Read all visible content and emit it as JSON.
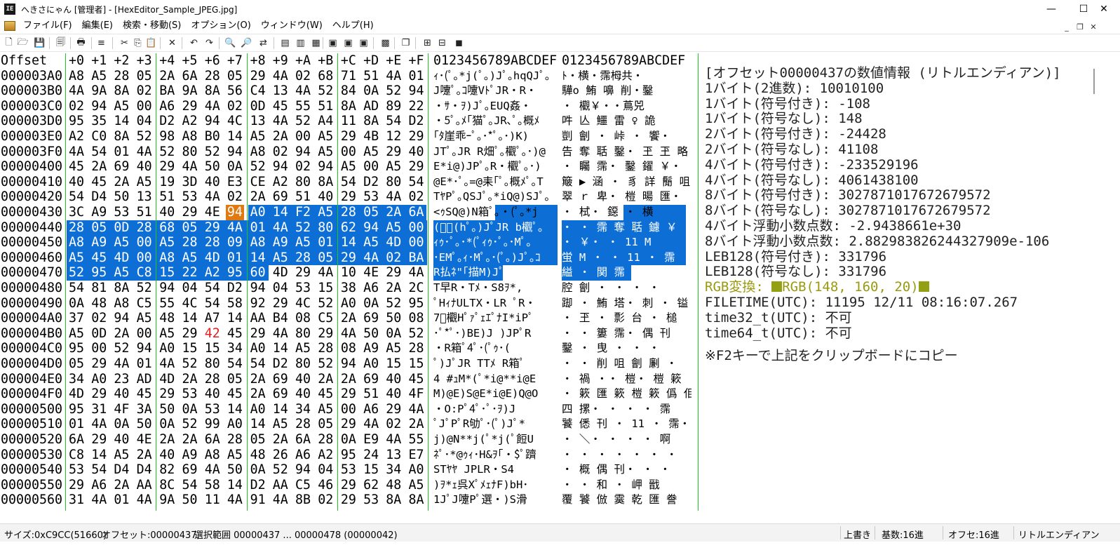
{
  "window": {
    "app_icon_text": "IE",
    "title": "へきさにゃん [管理者] - [HexEditor_Sample_JPEG.jpg]",
    "min_glyph": "—",
    "max_glyph": "☐",
    "close_glyph": "✕"
  },
  "menu": {
    "items": [
      "ファイル(F)",
      "編集(E)",
      "検索・移動(S)",
      "オプション(O)",
      "ウィンドウ(W)",
      "ヘルプ(H)"
    ],
    "mdi_min": "_",
    "mdi_restore": "❐",
    "mdi_close": "✕"
  },
  "toolbar": {
    "icons": [
      "new-file",
      "open-folder",
      "save",
      "properties",
      "print",
      "list",
      "cut",
      "copy",
      "paste",
      "delete",
      "undo",
      "redo",
      "search",
      "search-next",
      "replace",
      "insert-before",
      "insert-after",
      "insert-end",
      "mark-a",
      "mark-b",
      "mark-c",
      "struct",
      "window-list",
      "grid-1",
      "grid-2",
      "grid-3"
    ],
    "glyphs": [
      "🗋",
      "🗁",
      "💾",
      "🗐",
      "🖶",
      "≡",
      "✂",
      "⎘",
      "📋",
      "✕",
      "↶",
      "↷",
      "🔍",
      "🔎",
      "⇄",
      "▤",
      "▥",
      "▦",
      "▣",
      "▣",
      "▣",
      "▩",
      "❐",
      "⊞",
      "⊟",
      "◼"
    ]
  },
  "editor": {
    "offset_header": "Offset",
    "hex_headers": [
      "+0",
      "+1",
      "+2",
      "+3",
      "+4",
      "+5",
      "+6",
      "+7",
      "+8",
      "+9",
      "+A",
      "+B",
      "+C",
      "+D",
      "+E",
      "+F"
    ],
    "text_header_1": "0123456789ABCDEF",
    "text_header_2": "0123456789ABCDEF",
    "rows": [
      {
        "offset": "000003A0",
        "hex": [
          "A8",
          "A5",
          "28",
          "05",
          "2A",
          "6A",
          "28",
          "05",
          "29",
          "4A",
          "02",
          "68",
          "71",
          "51",
          "4A",
          "01"
        ],
        "text1": "ｨ･(ﾟ｡*j(ﾟ｡)Jﾟ｡hqQJﾟ｡",
        "text2": "ﾄ・横・霈栂共・"
      },
      {
        "offset": "000003B0",
        "hex": [
          "4A",
          "9A",
          "8A",
          "02",
          "BA",
          "9A",
          "8A",
          "56",
          "C4",
          "13",
          "4A",
          "52",
          "84",
          "0A",
          "52",
          "94"
        ],
        "text1": "J嚔ﾟ｡ｺ嚔VﾄﾟJR・R・",
        "text2": "驊o 鮪 嚊 削・鑿"
      },
      {
        "offset": "000003C0",
        "hex": [
          "02",
          "94",
          "A5",
          "00",
          "A6",
          "29",
          "4A",
          "02",
          "0D",
          "45",
          "55",
          "51",
          "8A",
          "AD",
          "89",
          "22"
        ],
        "text1": "・ｻ・ｦ)Jﾟ｡EUQ姦・",
        "text2": "・ 欟￥・・蔦兕"
      },
      {
        "offset": "000003D0",
        "hex": [
          "95",
          "35",
          "14",
          "04",
          "D2",
          "A2",
          "94",
          "4C",
          "13",
          "4A",
          "52",
          "A4",
          "11",
          "8A",
          "54",
          "D2"
        ],
        "text1": "・5ﾟ｡ﾒ｢猫ﾟ｡JR､ﾟ｡概ﾒ",
        "text2": "吽 亾 鱷 雷 ♀ 詭"
      },
      {
        "offset": "000003E0",
        "hex": [
          "A2",
          "C0",
          "8A",
          "52",
          "98",
          "A8",
          "B0",
          "14",
          "A5",
          "2A",
          "00",
          "A5",
          "29",
          "4B",
          "12",
          "29"
        ],
        "text1": "｢ﾀ崖乖ｰﾟ｡･*ﾟ｡･)K)",
        "text2": "剴 劊 ・ 峠 ・ 饗・"
      },
      {
        "offset": "000003F0",
        "hex": [
          "4A",
          "54",
          "01",
          "4A",
          "52",
          "80",
          "52",
          "94",
          "A8",
          "02",
          "94",
          "A5",
          "00",
          "A5",
          "29",
          "40"
        ],
        "text1": "JTﾟ｡JR R畑ﾟ｡欟ﾟ｡･)@",
        "text2": "告 奪 聒 鑿・ 玊 玊 略"
      },
      {
        "offset": "00000400",
        "hex": [
          "45",
          "2A",
          "69",
          "40",
          "29",
          "4A",
          "50",
          "0A",
          "52",
          "94",
          "02",
          "94",
          "A5",
          "00",
          "A5",
          "29"
        ],
        "text1": "E*i@)JPﾟ｡R・欟ﾟ｡･)",
        "text2": "・ 矚 霈・ 鑿 鑃 ￥・"
      },
      {
        "offset": "00000410",
        "hex": [
          "40",
          "45",
          "2A",
          "A5",
          "19",
          "3D",
          "40",
          "E3",
          "CE",
          "A2",
          "80",
          "8A",
          "54",
          "D2",
          "80",
          "54"
        ],
        "text1": "@E*･ﾟ｡=@耒｢ﾟ｡概ﾒﾟ｡T",
        "text2": "簸 ▶ 涵 ・ 豸 詳 鬜 咀"
      },
      {
        "offset": "00000420",
        "hex": [
          "54",
          "D4",
          "50",
          "13",
          "51",
          "53",
          "4A",
          "02",
          "2A",
          "69",
          "51",
          "40",
          "29",
          "53",
          "4A",
          "02"
        ],
        "text1": "TﾔPﾟ｡QSJﾟ｡*iQ@)SJﾟ｡",
        "text2": "翠 ｒ 卑・ 榿 暘 匯・"
      },
      {
        "offset": "00000430",
        "hex": [
          "3C",
          "A9",
          "53",
          "51",
          "40",
          "29",
          "4E",
          "94",
          "A0",
          "14",
          "F2",
          "A5",
          "28",
          "05",
          "2A",
          "6A"
        ],
        "text1": "<ｩSQ@)N箱ﾟ｡・(ﾟ｡*j",
        "text2": "・ 栻・ 鐚 ・ 横"
      },
      {
        "offset": "00000440",
        "hex": [
          "28",
          "05",
          "0D",
          "28",
          "68",
          "05",
          "29",
          "4A",
          "01",
          "4A",
          "52",
          "80",
          "62",
          "94",
          "A5",
          "00"
        ],
        "text1": "(ﾟ｡(hﾟ｡)JﾟJR b欟ﾟ｡",
        "text2": "・ ・ 霈 奪 聒 鑢 ￥"
      },
      {
        "offset": "00000450",
        "hex": [
          "A8",
          "A9",
          "A5",
          "00",
          "A5",
          "28",
          "28",
          "09",
          "A8",
          "A9",
          "A5",
          "01",
          "14",
          "A5",
          "4D",
          "00"
        ],
        "text1": "ｨｩ･ﾟ｡･*(ﾟｨｩ･ﾟ｡･Mﾟ｡",
        "text2": "・ ￥・ ・ 11 M"
      },
      {
        "offset": "00000460",
        "hex": [
          "A5",
          "45",
          "4D",
          "00",
          "A8",
          "A5",
          "4D",
          "01",
          "14",
          "A5",
          "28",
          "05",
          "29",
          "4A",
          "02",
          "BA"
        ],
        "text1": "･EMﾟ｡ｨ･Mﾟ｡･(ﾟ｡)Jﾟ｡ｺ",
        "text2": "蛍 M ・ ・ 11 ・ 霈"
      },
      {
        "offset": "00000470",
        "hex": [
          "52",
          "95",
          "A5",
          "C8",
          "15",
          "22",
          "A2",
          "95",
          "60",
          "4D",
          "29",
          "4A",
          "10",
          "4E",
          "29",
          "4A"
        ],
        "text1": "R払ﾈ\"｢描M)JﾟN)J",
        "text2": "縊 ・ 関 霈 丐 霈"
      },
      {
        "offset": "00000480",
        "hex": [
          "54",
          "81",
          "8A",
          "52",
          "94",
          "04",
          "54",
          "D2",
          "94",
          "04",
          "53",
          "15",
          "38",
          "A6",
          "2A",
          "2C"
        ],
        "text1": "T早R・Tﾒ・S8ｦ*,",
        "text2": "腔 劊 ・ ・ ・ ・"
      },
      {
        "offset": "00000490",
        "hex": [
          "0A",
          "48",
          "A8",
          "C5",
          "55",
          "4C",
          "54",
          "58",
          "92",
          "29",
          "4C",
          "52",
          "A0",
          "0A",
          "52",
          "95"
        ],
        "text1": "ﾟHｨﾅULTX・LR ﾟR・",
        "text2": "踋 ・ 鮪 塔・ 刺 ・ 镒"
      },
      {
        "offset": "000004A0",
        "hex": [
          "37",
          "02",
          "94",
          "A5",
          "48",
          "14",
          "A7",
          "14",
          "AA",
          "B4",
          "08",
          "C5",
          "2A",
          "69",
          "50",
          "08"
        ],
        "text1": "7ﾟ欟HﾟｧﾟｪｴﾟﾅI*iPﾟ",
        "text2": "・ 玊 ・ 彯 台 ・ 槌"
      },
      {
        "offset": "000004B0",
        "hex": [
          "A5",
          "0D",
          "2A",
          "00",
          "A5",
          "29",
          "42",
          "45",
          "29",
          "4A",
          "80",
          "29",
          "4A",
          "50",
          "0A",
          "52"
        ],
        "text1": "･ﾟ*ﾟ･)BE)J )JPﾟR",
        "text2": "・ ・ 簍 霈・ 偶 刊"
      },
      {
        "offset": "000004C0",
        "hex": [
          "95",
          "00",
          "52",
          "94",
          "A0",
          "15",
          "15",
          "34",
          "A0",
          "14",
          "A5",
          "28",
          "08",
          "A9",
          "A5",
          "28"
        ],
        "text1": "・R箱ﾟ4ﾟ･(ﾟｩ･(",
        "text2": "鑿 ・ 曳 ・ ・ ・"
      },
      {
        "offset": "000004D0",
        "hex": [
          "05",
          "29",
          "4A",
          "01",
          "4A",
          "52",
          "80",
          "54",
          "54",
          "D2",
          "80",
          "52",
          "94",
          "A0",
          "15",
          "15"
        ],
        "text1": "ﾟ)JﾟJR TTﾒ R箱ﾟ",
        "text2": "・ ・ 削 咀 劊 劆 ・"
      },
      {
        "offset": "000004E0",
        "hex": [
          "34",
          "A0",
          "23",
          "AD",
          "4D",
          "2A",
          "28",
          "05",
          "2A",
          "69",
          "40",
          "2A",
          "2A",
          "69",
          "40",
          "45"
        ],
        "text1": "4 #ｭM*(ﾟ*i@**i@E",
        "text2": "・ 禍 ・・ 榿・ 榿 簌"
      },
      {
        "offset": "000004F0",
        "hex": [
          "4D",
          "29",
          "40",
          "45",
          "29",
          "53",
          "40",
          "45",
          "2A",
          "69",
          "40",
          "45",
          "29",
          "51",
          "40",
          "4F"
        ],
        "text1": "M)@E)S@E*i@E)Q@O",
        "text2": "・ 簌 匯 簌 榿 簌 僞 佀"
      },
      {
        "offset": "00000500",
        "hex": [
          "95",
          "31",
          "4F",
          "3A",
          "50",
          "0A",
          "53",
          "14",
          "A0",
          "14",
          "34",
          "A5",
          "00",
          "A6",
          "29",
          "4A"
        ],
        "text1": "・O:Pﾟ4ﾟ･ﾟ･ｦ)J",
        "text2": "四 摞・ ・ ・ ・ 霈"
      },
      {
        "offset": "00000510",
        "hex": [
          "01",
          "4A",
          "0A",
          "50",
          "0A",
          "52",
          "99",
          "A0",
          "14",
          "A5",
          "28",
          "05",
          "29",
          "4A",
          "02",
          "2A"
        ],
        "text1": "ﾟJﾟPﾟR劬ﾟ･(ﾟ)Jﾟ*",
        "text2": "饕 僁 刊 ・ 11 ・ 霈・"
      },
      {
        "offset": "00000520",
        "hex": [
          "6A",
          "29",
          "40",
          "4E",
          "2A",
          "2A",
          "6A",
          "28",
          "05",
          "2A",
          "6A",
          "28",
          "0A",
          "E9",
          "4A",
          "55"
        ],
        "text1": "j)@N**j(ﾟ*j(ﾟ餖U",
        "text2": "・ ＼・ ・ ・ ・ 啊"
      },
      {
        "offset": "00000530",
        "hex": [
          "C8",
          "14",
          "A5",
          "2A",
          "40",
          "A9",
          "A8",
          "A5",
          "48",
          "26",
          "A6",
          "A2",
          "95",
          "24",
          "13",
          "E7"
        ],
        "text1": "ﾈﾟ･*@ｩｨ･H&ｦ｢・$ﾟ躋",
        "text2": "・ ・ ・ ・ ・ ・ ・"
      },
      {
        "offset": "00000540",
        "hex": [
          "53",
          "54",
          "D4",
          "D4",
          "82",
          "69",
          "4A",
          "50",
          "0A",
          "52",
          "94",
          "04",
          "53",
          "15",
          "34",
          "A0"
        ],
        "text1": "STﾔﾔ JPLR・S4",
        "text2": "・ 概 偶 刊・ ・ ・"
      },
      {
        "offset": "00000550",
        "hex": [
          "29",
          "A6",
          "2A",
          "AA",
          "8C",
          "54",
          "58",
          "14",
          "D2",
          "AA",
          "C5",
          "46",
          "29",
          "62",
          "48",
          "A5"
        ],
        "text1": ")ｦ*ｪ呉XﾟﾒｪﾅF)bH･",
        "text2": "・ ・ 和 ・ 岬 戩"
      },
      {
        "offset": "00000560",
        "hex": [
          "31",
          "4A",
          "01",
          "4A",
          "9A",
          "50",
          "11",
          "4A",
          "91",
          "4A",
          "8B",
          "02",
          "29",
          "53",
          "8A",
          "8A"
        ],
        "text1": "1JﾟJ嚔Pﾟ選・)S滑",
        "text2": "覆 饕 倣 霙 乾 匯 誊"
      }
    ],
    "selection_start_row": 9,
    "selection_start_col": 8,
    "selection_end_row": 13,
    "selection_end_col": 8,
    "cursor_row": 9,
    "cursor_col": 7,
    "red_mark_row": 17,
    "red_mark_col": 6
  },
  "info_panel": {
    "title": "[オフセット00000437の数値情報 (リトルエンディアン)]",
    "lines": [
      "1バイト(2進数): 10010100",
      "1バイト(符号付き): -108",
      "1バイト(符号なし): 148",
      "2バイト(符号付き): -24428",
      "2バイト(符号なし): 41108",
      "4バイト(符号付き): -233529196",
      "4バイト(符号なし): 4061438100",
      "8バイト(符号付き): 3027871017672679572",
      "8バイト(符号なし): 3027871017672679572",
      "4バイト浮動小数点数: -2.9438661e+30",
      "8バイト浮動小数点数: 2.882983826244327909e-106",
      "LEB128(符号付き): 331796",
      "LEB128(符号なし): 331796"
    ],
    "rgb_label": "RGB変換: ",
    "rgb_value": "RGB(148, 160, 20)",
    "rgb_color": "#94a014",
    "lines2": [
      "FILETIME(UTC): 11195 12/11 08:16:07.267",
      "time32_t(UTC): 不可",
      "time64_t(UTC): 不可"
    ],
    "copy_hint": "※F2キーで上記をクリップボードにコピー"
  },
  "status": {
    "size": "サイズ:0xC9CC(51660)",
    "offset": "オフセット:00000437,",
    "range": "選択範囲 00000437 ... 00000478 (00000042)",
    "mode": "上書き",
    "base": "基数:16進",
    "offset_base": "オフセ:16進",
    "endian": "リトルエンディアン"
  },
  "colors": {
    "selection": "#0d6fd6",
    "cursor": "#e07a10",
    "grid": "#22c422",
    "red_mark": "#e02020"
  }
}
